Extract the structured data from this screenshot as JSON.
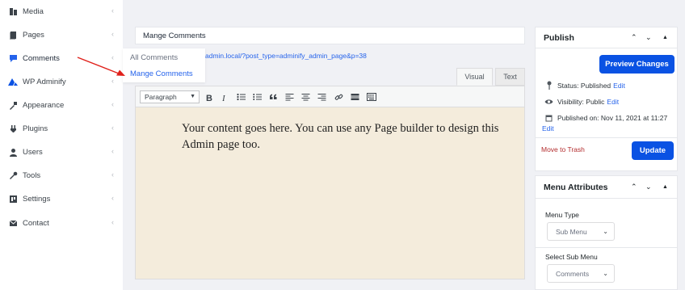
{
  "sidebar": {
    "items": [
      {
        "label": "Media",
        "icon": "media-icon"
      },
      {
        "label": "Pages",
        "icon": "pages-icon"
      },
      {
        "label": "Comments",
        "icon": "comments-icon"
      },
      {
        "label": "WP Adminify",
        "icon": "adminify-icon"
      },
      {
        "label": "Appearance",
        "icon": "appearance-icon"
      },
      {
        "label": "Plugins",
        "icon": "plugins-icon"
      },
      {
        "label": "Users",
        "icon": "users-icon"
      },
      {
        "label": "Tools",
        "icon": "tools-icon"
      },
      {
        "label": "Settings",
        "icon": "settings-icon"
      },
      {
        "label": "Contact",
        "icon": "contact-icon"
      }
    ]
  },
  "flyout": {
    "items": [
      {
        "label": "All Comments"
      },
      {
        "label": "Mange Comments"
      }
    ]
  },
  "editor": {
    "title": "Mange Comments",
    "permalink": "admin.local/?post_type=adminify_admin_page&p=38",
    "tabs": {
      "visual": "Visual",
      "text": "Text"
    },
    "format": "Paragraph",
    "content": "Your content goes here. You can use any Page builder to design this Admin page too."
  },
  "publish": {
    "title": "Publish",
    "preview_label": "Preview Changes",
    "status_label": "Status: Published",
    "visibility_label": "Visibility: Public",
    "published_label": "Published on: Nov 11, 2021 at 11:27",
    "edit_label": "Edit",
    "trash_label": "Move to Trash",
    "update_label": "Update"
  },
  "menu_attributes": {
    "title": "Menu Attributes",
    "menu_type_label": "Menu Type",
    "menu_type_value": "Sub Menu",
    "sub_menu_label": "Select Sub Menu",
    "sub_menu_value": "Comments"
  },
  "colors": {
    "accent": "#0a52e3",
    "link": "#2563eb",
    "trash": "#b32d2e",
    "arrow": "#e0201a",
    "editor_bg": "#f4ecdc"
  }
}
